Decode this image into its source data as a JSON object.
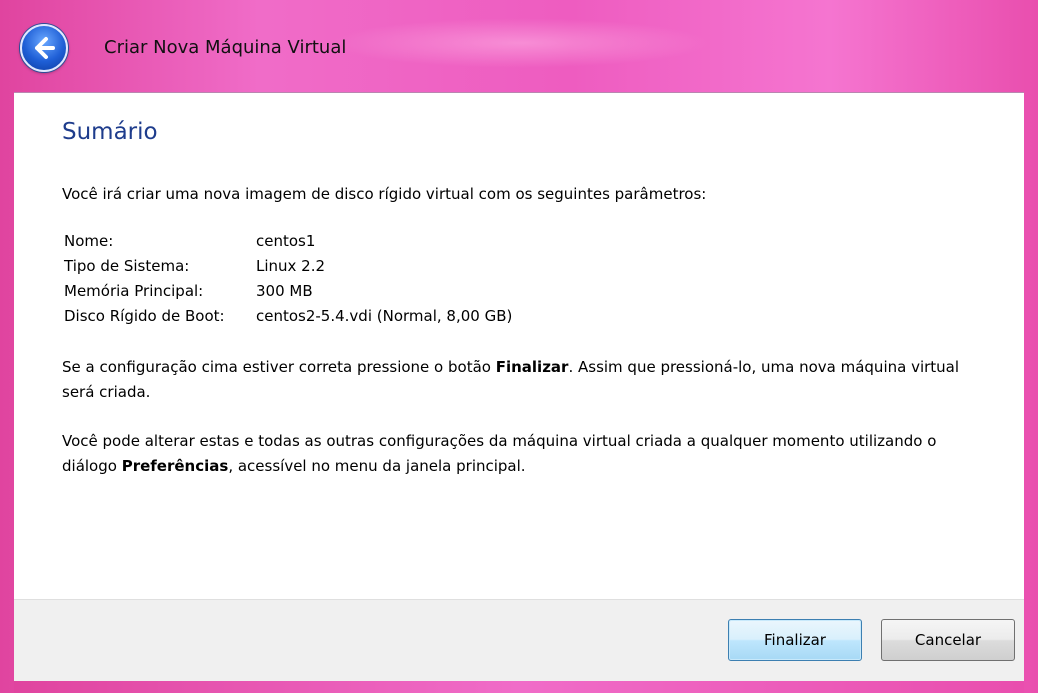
{
  "window": {
    "title": "Criar Nova Máquina Virtual"
  },
  "page": {
    "heading": "Sumário",
    "intro": "Você irá criar uma nova imagem de disco rígido virtual com os seguintes parâmetros:",
    "params": [
      {
        "key": "Nome:",
        "value": "centos1"
      },
      {
        "key": "Tipo de Sistema:",
        "value": "Linux 2.2"
      },
      {
        "key": "Memória Principal:",
        "value": "300 MB"
      },
      {
        "key": "Disco Rígido de Boot:",
        "value": "centos2-5.4.vdi (Normal, 8,00 GB)"
      }
    ],
    "para1_before": "Se a configuração cima estiver correta pressione o botão ",
    "para1_bold": "Finalizar",
    "para1_after": ". Assim que pressioná-lo, uma nova máquina virtual será criada.",
    "para2_before": "Você pode alterar estas e todas as outras configurações da máquina virtual criada a qualquer momento utilizando o diálogo ",
    "para2_bold": "Preferências",
    "para2_after": ", acessível no menu da janela principal."
  },
  "buttons": {
    "finish": "Finalizar",
    "cancel": "Cancelar"
  },
  "icons": {
    "back": "back-arrow-icon"
  },
  "colors": {
    "frame": "#ee5cc0",
    "heading": "#1e3c8c",
    "primary_button": "#bee6fd"
  }
}
